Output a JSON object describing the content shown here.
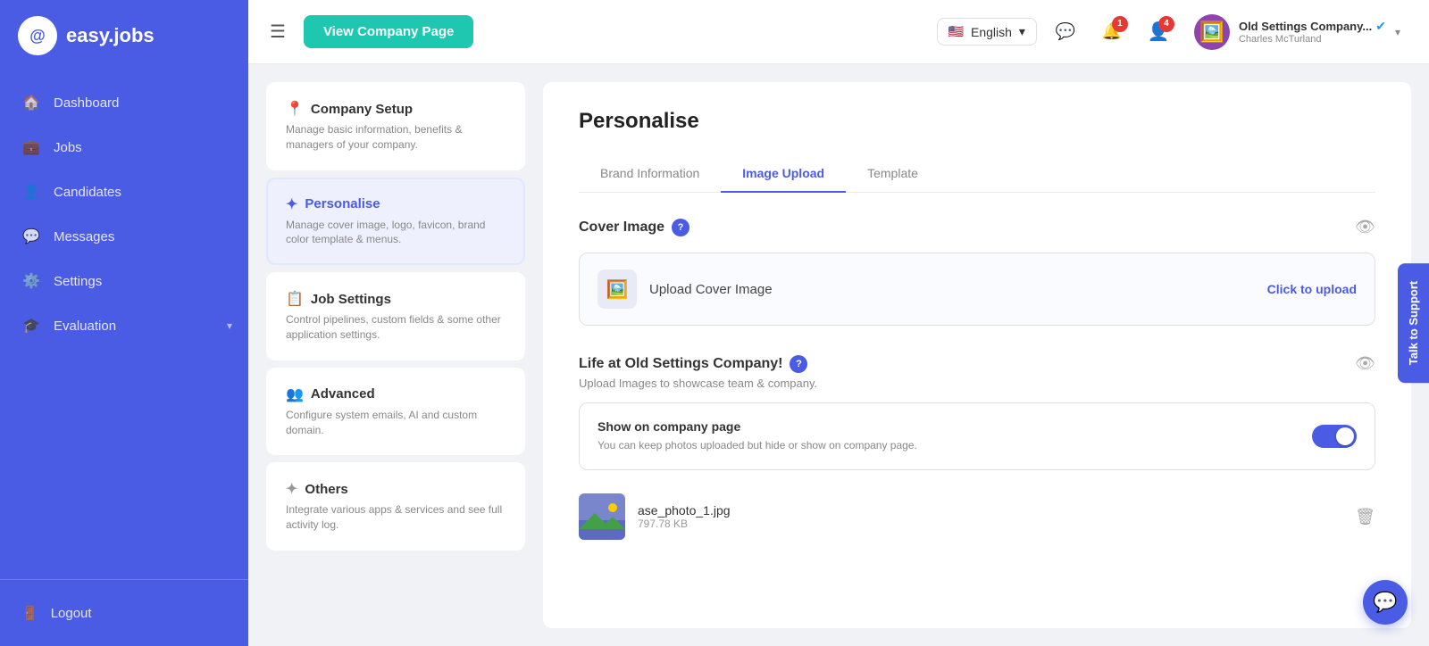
{
  "sidebar": {
    "logo_letter": "@",
    "logo_text": "easy.jobs",
    "nav_items": [
      {
        "id": "dashboard",
        "label": "Dashboard",
        "icon": "🏠"
      },
      {
        "id": "jobs",
        "label": "Jobs",
        "icon": "💼"
      },
      {
        "id": "candidates",
        "label": "Candidates",
        "icon": "👤"
      },
      {
        "id": "messages",
        "label": "Messages",
        "icon": "💬"
      },
      {
        "id": "settings",
        "label": "Settings",
        "icon": "⚙️"
      },
      {
        "id": "evaluation",
        "label": "Evaluation",
        "icon": "🎓",
        "has_chevron": true
      }
    ],
    "logout_label": "Logout",
    "logout_icon": "🚪"
  },
  "header": {
    "view_company_label": "View Company Page",
    "language_label": "English",
    "notification_badge_1": "1",
    "notification_badge_2": "4",
    "user_name": "Old Settings Company...",
    "user_sub": "Charles McTurland",
    "chevron": "▾"
  },
  "left_panel": {
    "cards": [
      {
        "id": "company-setup",
        "icon": "📍",
        "title": "Company Setup",
        "desc": "Manage basic information, benefits & managers of your company.",
        "active": false
      },
      {
        "id": "personalise",
        "icon": "✨",
        "title": "Personalise",
        "desc": "Manage cover image, logo, favicon, brand color template & menus.",
        "active": true
      },
      {
        "id": "job-settings",
        "icon": "📋",
        "title": "Job Settings",
        "desc": "Control pipelines, custom fields & some other application settings.",
        "active": false
      },
      {
        "id": "advanced",
        "icon": "👥",
        "title": "Advanced",
        "desc": "Configure system emails, AI and custom domain.",
        "active": false
      },
      {
        "id": "others",
        "icon": "✦",
        "title": "Others",
        "desc": "Integrate various apps & services and see full activity log.",
        "active": false
      }
    ]
  },
  "main": {
    "page_title": "Personalise",
    "tabs": [
      {
        "id": "brand-information",
        "label": "Brand Information",
        "active": false
      },
      {
        "id": "image-upload",
        "label": "Image Upload",
        "active": true
      },
      {
        "id": "template",
        "label": "Template",
        "active": false
      }
    ],
    "cover_image": {
      "section_title": "Cover Image",
      "upload_label": "Upload Cover Image",
      "upload_link": "Click to upload"
    },
    "life_section": {
      "title": "Life at Old Settings Company!",
      "subtitle": "Upload Images to showcase team & company.",
      "show_on_page_title": "Show on company page",
      "show_on_page_desc": "You can keep photos uploaded but hide or show on company page.",
      "toggle_on": true,
      "photo": {
        "name": "ase_photo_1.jpg",
        "size": "797.78 KB"
      }
    }
  },
  "support_label": "Talk to Support",
  "chat_icon": "💬"
}
